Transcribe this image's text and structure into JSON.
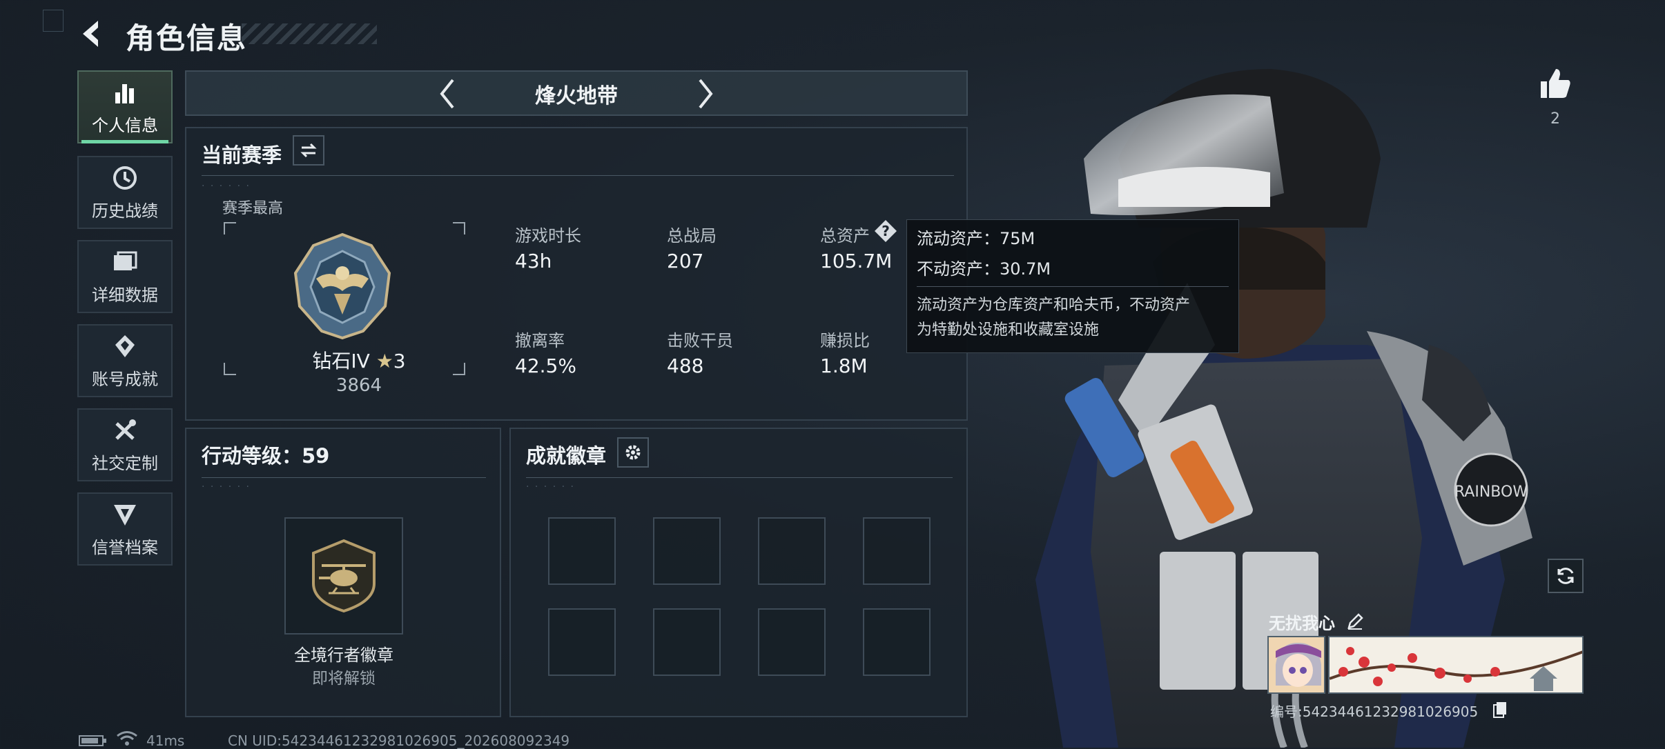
{
  "header": {
    "title": "角色信息"
  },
  "sidebar": {
    "items": [
      {
        "label": "个人信息",
        "icon": "bar-chart-icon",
        "active": true
      },
      {
        "label": "历史战绩",
        "icon": "history-icon"
      },
      {
        "label": "详细数据",
        "icon": "folder-icon"
      },
      {
        "label": "账号成就",
        "icon": "achievement-icon"
      },
      {
        "label": "社交定制",
        "icon": "tools-icon"
      },
      {
        "label": "信誉档案",
        "icon": "shield-badge-icon"
      }
    ]
  },
  "mode": {
    "title": "烽火地带"
  },
  "season": {
    "title": "当前赛季",
    "best_label": "赛季最高",
    "rank_name": "钻石IV",
    "rank_stars": "3",
    "rank_score": "3864",
    "stats": [
      {
        "label": "游戏时长",
        "value": "43h"
      },
      {
        "label": "总战局",
        "value": "207"
      },
      {
        "label": "总资产",
        "value": "105.7M"
      },
      {
        "label": "撤离率",
        "value": "42.5%"
      },
      {
        "label": "击败干员",
        "value": "488"
      },
      {
        "label": "赚损比",
        "value": "1.8M"
      }
    ]
  },
  "tooltip": {
    "line1": "流动资产：75M",
    "line2": "不动资产：30.7M",
    "desc1": "流动资产为仓库资产和哈夫币，不动资产",
    "desc2": "为特勤处设施和收藏室设施"
  },
  "level": {
    "title": "行动等级：59",
    "badge_name": "全境行者徽章",
    "badge_status": "即将解锁"
  },
  "achievements": {
    "title": "成就徽章",
    "slots": 8
  },
  "likes": {
    "count": "2"
  },
  "profile": {
    "name": "无扰我心",
    "id_text": "编号:5423446123298102690​5"
  },
  "status_bar": {
    "ping": "41ms",
    "uid": "CN UID:5423446123298102690​5_20260809234​9"
  },
  "colors": {
    "accent": "#6fd6a6",
    "background": "#1b232c",
    "tooltip_bg": "#0c1014"
  }
}
